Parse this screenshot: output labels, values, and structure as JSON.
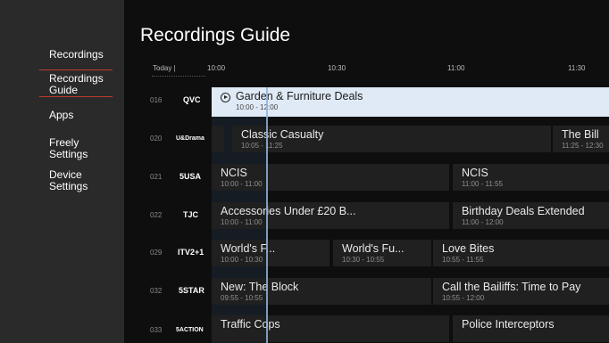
{
  "sidebar": {
    "items": [
      {
        "label": "Recordings"
      },
      {
        "label": "Recordings Guide",
        "active": true
      },
      {
        "label": "Apps"
      },
      {
        "label": "Freely Settings"
      },
      {
        "label": "Device Settings"
      }
    ],
    "accent": "#c0392b"
  },
  "page": {
    "title": "Recordings Guide"
  },
  "timebar": {
    "today": "Today |",
    "times": [
      "10:00",
      "10:30",
      "11:00",
      "11:30"
    ]
  },
  "rows": [
    {
      "num": "016",
      "name": "QVC",
      "programs": [
        {
          "title": "Garden & Furniture Deals",
          "time": "10:00 - 12:00",
          "selected": true
        }
      ]
    },
    {
      "num": "020",
      "name": "U&Drama",
      "programs": [
        {
          "title": "Classic Casualty",
          "time": "10:05 - 11:25"
        },
        {
          "title": "The Bill",
          "time": "11:25 - 12:30"
        }
      ]
    },
    {
      "num": "021",
      "name": "5USA",
      "programs": [
        {
          "title": "NCIS",
          "time": "10:00 - 11:00"
        },
        {
          "title": "NCIS",
          "time": "11:00 - 11:55"
        }
      ]
    },
    {
      "num": "022",
      "name": "TJC",
      "programs": [
        {
          "title": "Accessories Under £20 B...",
          "time": "10:00 - 11:00"
        },
        {
          "title": "Birthday Deals Extended",
          "time": "11:00 - 12:00"
        }
      ]
    },
    {
      "num": "029",
      "name": "ITV2+1",
      "programs": [
        {
          "title": "World's F...",
          "time": "10:00 - 10:30"
        },
        {
          "title": "World's Fu...",
          "time": "10:30 - 10:55"
        },
        {
          "title": "Love Bites",
          "time": "10:55 - 11:55"
        }
      ]
    },
    {
      "num": "032",
      "name": "5STAR",
      "programs": [
        {
          "title": "New: The Block",
          "time": "09:55 - 10:55"
        },
        {
          "title": "Call the Bailiffs: Time to Pay",
          "time": "10:55 - 12:00"
        }
      ]
    },
    {
      "num": "033",
      "name": "5ACTION",
      "programs": [
        {
          "title": "Traffic Cops",
          "time": ""
        },
        {
          "title": "Police Interceptors",
          "time": ""
        }
      ]
    }
  ]
}
